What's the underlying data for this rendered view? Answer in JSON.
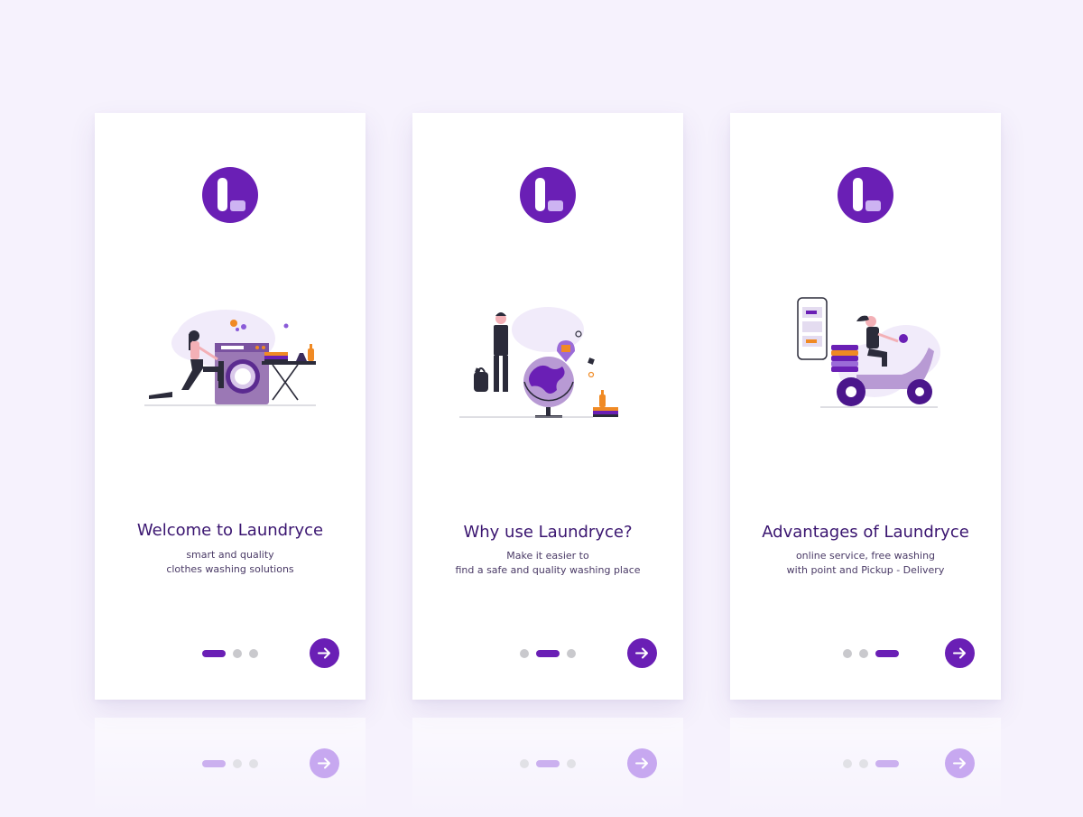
{
  "brand": {
    "accent": "#6a1fb5",
    "title_color": "#3a1570",
    "background": "#f6f2fd"
  },
  "screens": [
    {
      "title": "Welcome to Laundryce",
      "subtitle_line1": "smart and quality",
      "subtitle_line2": "clothes washing solutions",
      "illustration": "woman-at-washing-machine",
      "active_page": 1,
      "page_count": 3,
      "next_icon": "arrow-right-icon"
    },
    {
      "title": "Why use Laundryce?",
      "subtitle_line1": "Make it easier to",
      "subtitle_line2": "find a safe and quality washing place",
      "illustration": "man-with-globe",
      "active_page": 2,
      "page_count": 3,
      "next_icon": "arrow-right-icon"
    },
    {
      "title": "Advantages of Laundryce",
      "subtitle_line1": "online service, free washing",
      "subtitle_line2": "with point and Pickup - Delivery",
      "illustration": "delivery-scooter-with-phone",
      "active_page": 3,
      "page_count": 3,
      "next_icon": "arrow-right-icon"
    }
  ]
}
